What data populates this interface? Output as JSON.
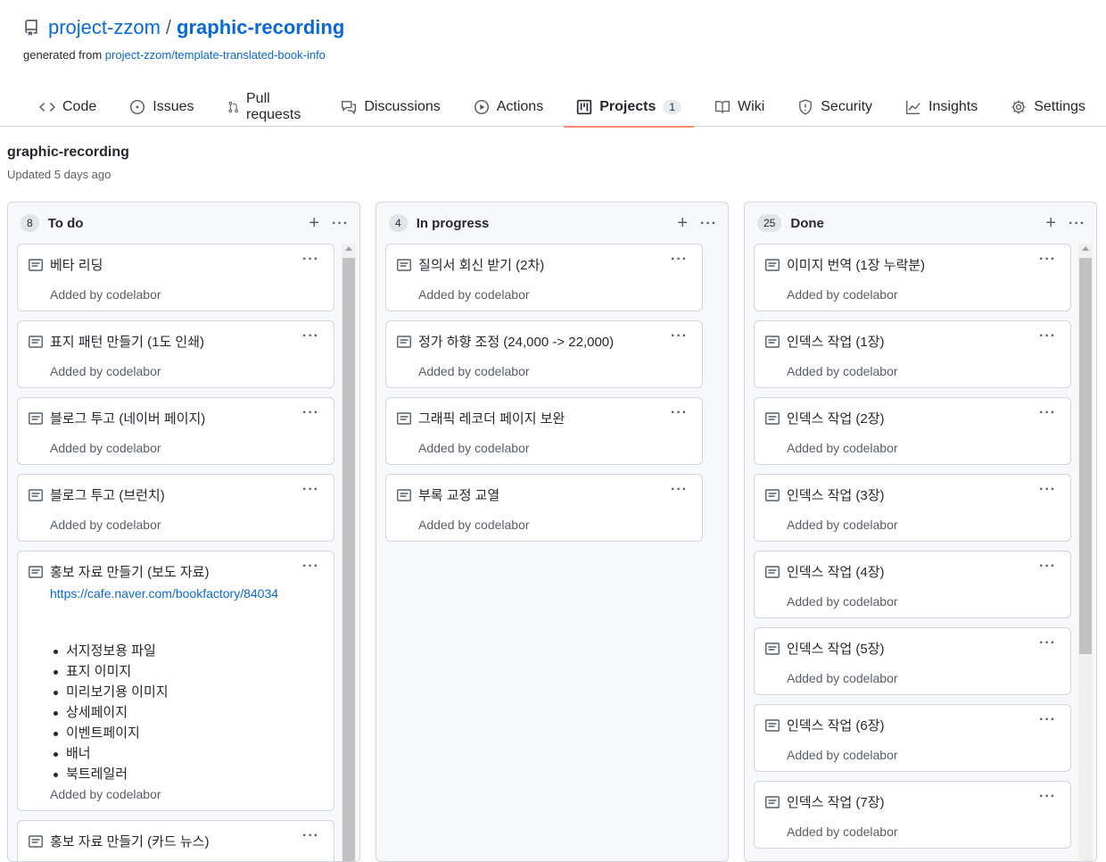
{
  "repo": {
    "owner": "project-zzom",
    "separator": "/",
    "name": "graphic-recording",
    "generated_prefix": "generated from",
    "generated_link": "project-zzom/template-translated-book-info"
  },
  "nav": [
    {
      "label": "Code",
      "icon": "code-icon"
    },
    {
      "label": "Issues",
      "icon": "issue-icon"
    },
    {
      "label": "Pull requests",
      "icon": "pull-request-icon"
    },
    {
      "label": "Discussions",
      "icon": "discussion-icon"
    },
    {
      "label": "Actions",
      "icon": "play-icon"
    },
    {
      "label": "Projects",
      "icon": "project-icon",
      "counter": "1",
      "active": true
    },
    {
      "label": "Wiki",
      "icon": "book-icon"
    },
    {
      "label": "Security",
      "icon": "shield-icon"
    },
    {
      "label": "Insights",
      "icon": "graph-icon"
    },
    {
      "label": "Settings",
      "icon": "gear-icon"
    }
  ],
  "project": {
    "title": "graphic-recording",
    "updated": "Updated 5 days ago"
  },
  "columns": [
    {
      "count": "8",
      "title": "To do",
      "cards": [
        {
          "title": "베타 리딩",
          "added": "Added by codelabor"
        },
        {
          "title": "표지 패턴 만들기 (1도 인쇄)",
          "added": "Added by codelabor"
        },
        {
          "title": "블로그 투고 (네이버 페이지)",
          "added": "Added by codelabor"
        },
        {
          "title": "블로그 투고 (브런치)",
          "added": "Added by codelabor"
        },
        {
          "title": "홍보 자료 만들기 (보도 자료)",
          "link": "https://cafe.naver.com/bookfactory/84034",
          "bullets": [
            "서지정보용 파일",
            "표지 이미지",
            "미리보기용 이미지",
            "상세페이지",
            "이벤트페이지",
            "배너",
            "북트레일러"
          ],
          "added": "Added by codelabor"
        },
        {
          "title": "홍보 자료 만들기 (카드 뉴스)",
          "added": ""
        }
      ]
    },
    {
      "count": "4",
      "title": "In progress",
      "cards": [
        {
          "title": "질의서 회신 받기 (2차)",
          "added": "Added by codelabor"
        },
        {
          "title": "정가 하향 조정 (24,000 -> 22,000)",
          "added": "Added by codelabor"
        },
        {
          "title": "그래픽 레코더 페이지 보완",
          "added": "Added by codelabor"
        },
        {
          "title": "부록 교정 교열",
          "added": "Added by codelabor"
        }
      ]
    },
    {
      "count": "25",
      "title": "Done",
      "cards": [
        {
          "title": "이미지 번역 (1장 누락분)",
          "added": "Added by codelabor"
        },
        {
          "title": "인덱스 작업 (1장)",
          "added": "Added by codelabor"
        },
        {
          "title": "인덱스 작업 (2장)",
          "added": "Added by codelabor"
        },
        {
          "title": "인덱스 작업 (3장)",
          "added": "Added by codelabor"
        },
        {
          "title": "인덱스 작업 (4장)",
          "added": "Added by codelabor"
        },
        {
          "title": "인덱스 작업 (5장)",
          "added": "Added by codelabor"
        },
        {
          "title": "인덱스 작업 (6장)",
          "added": "Added by codelabor"
        },
        {
          "title": "인덱스 작업 (7장)",
          "added": "Added by codelabor"
        }
      ]
    }
  ],
  "ui": {
    "add_glyph": "+",
    "more_glyph": "···"
  }
}
